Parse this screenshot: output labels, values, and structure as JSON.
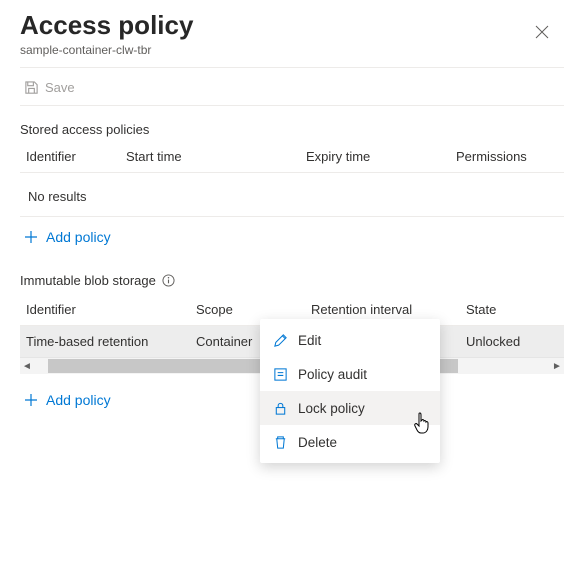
{
  "header": {
    "title": "Access policy",
    "subtitle": "sample-container-clw-tbr"
  },
  "toolbar": {
    "save_label": "Save"
  },
  "stored_policies": {
    "section_title": "Stored access policies",
    "columns": {
      "identifier": "Identifier",
      "start": "Start time",
      "expiry": "Expiry time",
      "perms": "Permissions"
    },
    "empty": "No results",
    "add_label": "Add policy"
  },
  "immutable": {
    "section_title": "Immutable blob storage",
    "columns": {
      "identifier": "Identifier",
      "scope": "Scope",
      "retention": "Retention interval",
      "state": "State"
    },
    "rows": [
      {
        "identifier": "Time-based retention",
        "scope": "Container",
        "retention": "",
        "state": "Unlocked"
      }
    ],
    "add_label": "Add policy"
  },
  "context_menu": {
    "edit": "Edit",
    "audit": "Policy audit",
    "lock": "Lock policy",
    "delete": "Delete"
  }
}
